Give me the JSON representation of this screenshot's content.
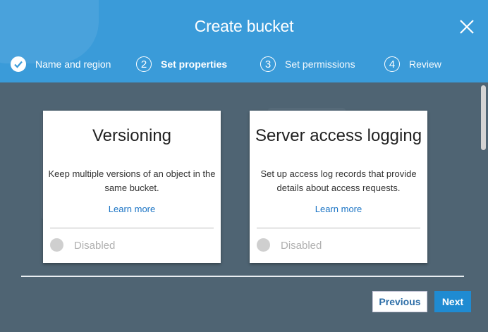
{
  "dialog": {
    "title": "Create bucket"
  },
  "steps": [
    {
      "number": "",
      "label": "Name and region",
      "state": "done"
    },
    {
      "number": "2",
      "label": "Set properties",
      "state": "active"
    },
    {
      "number": "3",
      "label": "Set permissions",
      "state": "pending"
    },
    {
      "number": "4",
      "label": "Review",
      "state": "pending"
    }
  ],
  "cards": [
    {
      "title": "Versioning",
      "description": "Keep multiple versions of an object in the same bucket.",
      "link": "Learn more",
      "status": "Disabled"
    },
    {
      "title": "Server access logging",
      "description": "Set up access log records that provide details about access requests.",
      "link": "Learn more",
      "status": "Disabled"
    }
  ],
  "footer": {
    "previous_label": "Previous",
    "next_label": "Next"
  },
  "colors": {
    "header": "#3a9bd9",
    "body": "#4f6473",
    "link": "#1a73c4",
    "primary_button": "#1f8bd2"
  }
}
